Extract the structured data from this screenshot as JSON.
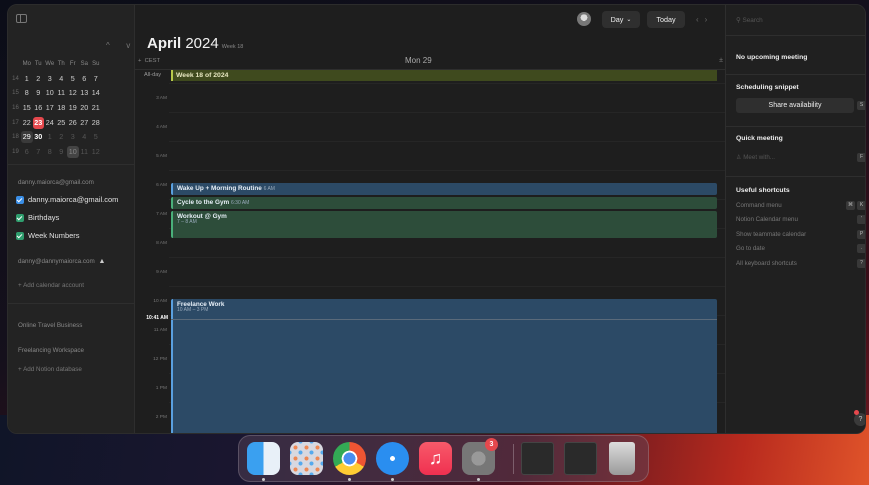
{
  "sidebar": {
    "weekday_headers": [
      "Mo",
      "Tu",
      "We",
      "Th",
      "Fr",
      "Sa",
      "Su"
    ],
    "weeks": [
      {
        "num": "14",
        "days": [
          "1",
          "2",
          "3",
          "4",
          "5",
          "6",
          "7"
        ]
      },
      {
        "num": "15",
        "days": [
          "8",
          "9",
          "10",
          "11",
          "12",
          "13",
          "14"
        ]
      },
      {
        "num": "16",
        "days": [
          "15",
          "16",
          "17",
          "18",
          "19",
          "20",
          "21"
        ]
      },
      {
        "num": "17",
        "days": [
          "22",
          "23",
          "24",
          "25",
          "26",
          "27",
          "28"
        ]
      },
      {
        "num": "18",
        "days": [
          "29",
          "30",
          "1",
          "2",
          "3",
          "4",
          "5"
        ]
      },
      {
        "num": "19",
        "days": [
          "6",
          "7",
          "8",
          "9",
          "10",
          "11",
          "12"
        ]
      }
    ],
    "account1": "danny.maiorca@gmail.com",
    "calendars": [
      {
        "label": "danny.maiorca@gmail.com",
        "color": "#3a8ee6"
      },
      {
        "label": "Birthdays",
        "color": "#2f9e6e"
      },
      {
        "label": "Week Numbers",
        "color": "#2f9e6e"
      }
    ],
    "account2": "danny@dannymaiorca.com",
    "account2_icon": "warning-icon",
    "add_account": "Add calendar account",
    "workspaces": [
      "Online Travel Business",
      "Freelancing Workspace"
    ],
    "add_notion": "Add Notion database"
  },
  "header": {
    "month": "April",
    "year": "2024",
    "week_label": "Week 18",
    "view_label": "Day",
    "today_label": "Today",
    "prev_icon": "chevron-left-icon",
    "next_icon": "chevron-right-icon"
  },
  "grid": {
    "timezone": "CEST",
    "day_header": "Mon 29",
    "all_day_label": "All-day",
    "all_day_event": "Week 18 of 2024",
    "hours": [
      "3 AM",
      "4 AM",
      "5 AM",
      "6 AM",
      "7 AM",
      "8 AM",
      "9 AM",
      "10 AM",
      "11 AM",
      "12 PM",
      "1 PM",
      "2 PM"
    ],
    "now_label": "10:41 AM",
    "events": [
      {
        "title": "Wake Up + Morning Routine",
        "time": "6 AM",
        "color": "#2c4a66",
        "bar": "#5aa0e0"
      },
      {
        "title": "Cycle to the Gym",
        "time": "6:30 AM",
        "color": "#2d4d3a",
        "bar": "#4ab07a"
      },
      {
        "title": "Workout @ Gym",
        "time": "7 – 8 AM",
        "color": "#2d4d3a",
        "bar": "#4ab07a"
      },
      {
        "title": "Freelance Work",
        "time": "10 AM – 3 PM",
        "color": "#2c4a66",
        "bar": "#5aa0e0"
      }
    ]
  },
  "right_panel": {
    "search_placeholder": "Search",
    "no_meeting": "No upcoming meeting",
    "snippet_title": "Scheduling snippet",
    "share_label": "Share availability",
    "share_key": "S",
    "quick_title": "Quick meeting",
    "quick_placeholder": "Meet with...",
    "quick_key": "F",
    "shortcuts_title": "Useful shortcuts",
    "shortcuts": [
      {
        "label": "Command menu",
        "keys": [
          "⌘",
          "K"
        ]
      },
      {
        "label": "Notion Calendar menu",
        "keys": [
          "'"
        ]
      },
      {
        "label": "Show teammate calendar",
        "keys": [
          "P"
        ]
      },
      {
        "label": "Go to date",
        "keys": [
          "."
        ]
      },
      {
        "label": "All keyboard shortcuts",
        "keys": [
          "?"
        ]
      }
    ],
    "help_label": "?"
  },
  "dock": {
    "apps": [
      "finder",
      "launchpad",
      "chrome",
      "safari",
      "music",
      "system-settings",
      "window-1",
      "window-2",
      "trash"
    ],
    "settings_badge": "3"
  }
}
